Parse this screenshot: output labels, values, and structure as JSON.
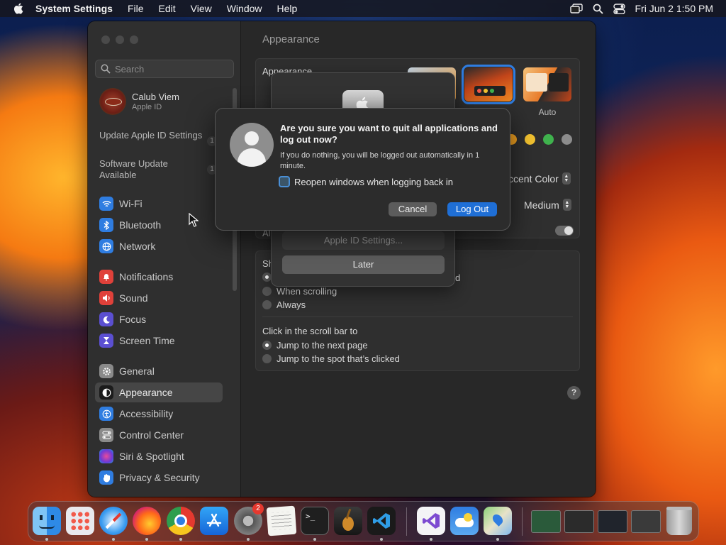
{
  "menubar": {
    "app_name": "System Settings",
    "menus": [
      "File",
      "Edit",
      "View",
      "Window",
      "Help"
    ],
    "datetime": "Fri Jun 2  1:50 PM"
  },
  "sidebar": {
    "search_placeholder": "Search",
    "profile": {
      "name": "Calub Viem",
      "subtitle": "Apple ID"
    },
    "notices": [
      {
        "label": "Update Apple ID Settings",
        "badge": "1"
      },
      {
        "label": "Software Update Available",
        "badge": "1"
      }
    ],
    "items": [
      {
        "label": "Wi-Fi",
        "color": "#2f7de1"
      },
      {
        "label": "Bluetooth",
        "color": "#2f7de1"
      },
      {
        "label": "Network",
        "color": "#2f7de1"
      },
      {
        "label": "Notifications",
        "color": "#e0413a"
      },
      {
        "label": "Sound",
        "color": "#e0413a"
      },
      {
        "label": "Focus",
        "color": "#5b4fd1"
      },
      {
        "label": "Screen Time",
        "color": "#5b4fd1"
      },
      {
        "label": "General",
        "color": "#8a8a8a"
      },
      {
        "label": "Appearance",
        "color": "#1c1c1c",
        "selected": true
      },
      {
        "label": "Accessibility",
        "color": "#2f7de1"
      },
      {
        "label": "Control Center",
        "color": "#8a8a8a"
      },
      {
        "label": "Siri & Spotlight",
        "color": "#9b4fd1"
      },
      {
        "label": "Privacy & Security",
        "color": "#2f7de1"
      }
    ]
  },
  "main": {
    "title": "Appearance",
    "appearance_label": "Appearance",
    "auto_label": "Auto",
    "accent_label": "ccent Color",
    "highlight_value": "Medium",
    "show_scroll_partial": "Sh",
    "allow_partial": "Al",
    "show_scroll_options": [
      {
        "label": "d",
        "selected": true
      },
      {
        "label": "When scrolling",
        "selected": false
      },
      {
        "label": "Always",
        "selected": false
      }
    ],
    "click_scroll_label": "Click in the scroll bar to",
    "click_scroll_options": [
      {
        "label": "Jump to the next page",
        "selected": true
      },
      {
        "label": "Jump to the spot that’s clicked",
        "selected": false
      }
    ],
    "help": "?",
    "accent_colors": [
      "#f0a020",
      "#f2c230",
      "#3fb24d",
      "#8c8c8c"
    ]
  },
  "sheet": {
    "apple_id_button": "Apple ID Settings...",
    "later_button": "Later"
  },
  "alert": {
    "question": "Are you sure you want to quit all applications and log out now?",
    "detail": "If you do nothing, you will be logged out automatically in 1 minute.",
    "checkbox_label": "Reopen windows when logging back in",
    "cancel": "Cancel",
    "confirm": "Log Out"
  },
  "dock": {
    "settings_badge": "2",
    "apps": [
      "finder-icon",
      "launchpad-icon",
      "safari-icon",
      "firefox-icon",
      "chrome-icon",
      "app-store-icon",
      "system-settings-icon",
      "textedit-icon",
      "terminal-icon",
      "garageband-icon",
      "vscode-icon",
      "visual-studio-icon",
      "weather-icon",
      "maps-icon"
    ]
  }
}
